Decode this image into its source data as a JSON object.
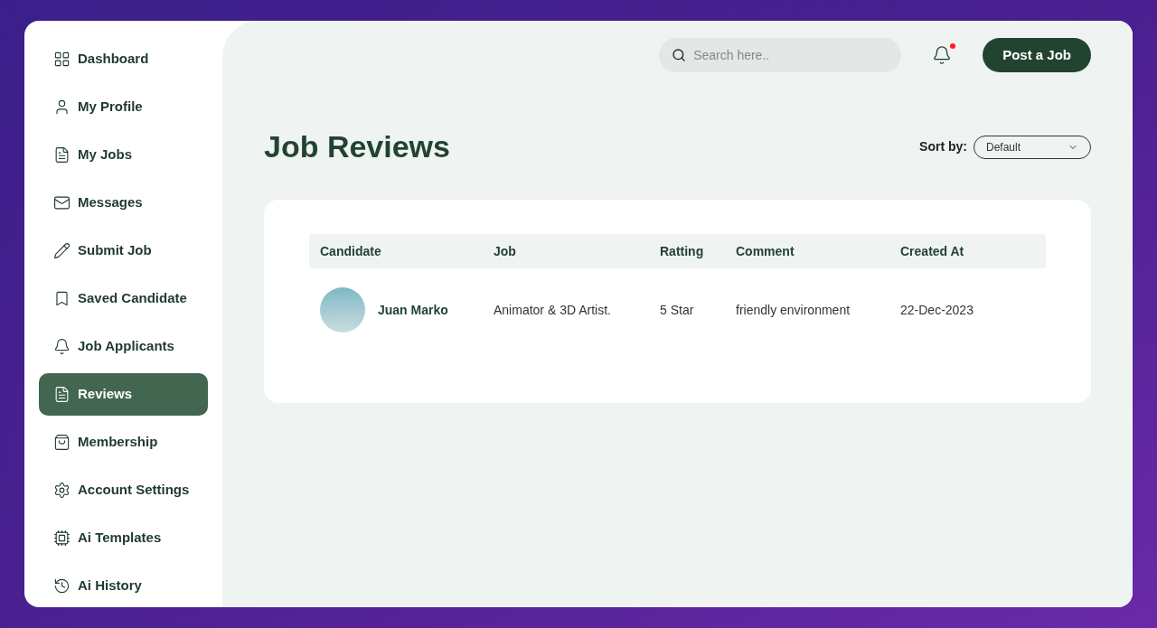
{
  "sidebar": {
    "items": [
      {
        "label": "Dashboard",
        "selected": false
      },
      {
        "label": "My Profile",
        "selected": false
      },
      {
        "label": "My Jobs",
        "selected": false
      },
      {
        "label": "Messages",
        "selected": false
      },
      {
        "label": "Submit Job",
        "selected": false
      },
      {
        "label": "Saved Candidate",
        "selected": false
      },
      {
        "label": "Job Applicants",
        "selected": false
      },
      {
        "label": "Reviews",
        "selected": true
      },
      {
        "label": "Membership",
        "selected": false
      },
      {
        "label": "Account Settings",
        "selected": false
      },
      {
        "label": "Ai Templates",
        "selected": false
      },
      {
        "label": "Ai History",
        "selected": false
      }
    ]
  },
  "header": {
    "search": {
      "placeholder": "Search here.."
    },
    "notifications": {
      "unread": true
    },
    "post_button": "Post a Job"
  },
  "page_title": "Job Reviews",
  "sort": {
    "label": "Sort by:",
    "value": "Default"
  },
  "table": {
    "columns": [
      "Candidate",
      "Job",
      "Ratting",
      "Comment",
      "Created At"
    ],
    "rows": [
      {
        "candidate": "Juan Marko",
        "job": "Animator & 3D Artist.",
        "rating": "5 Star",
        "comment": "friendly environment",
        "created_at": "22-Dec-2023"
      }
    ]
  }
}
